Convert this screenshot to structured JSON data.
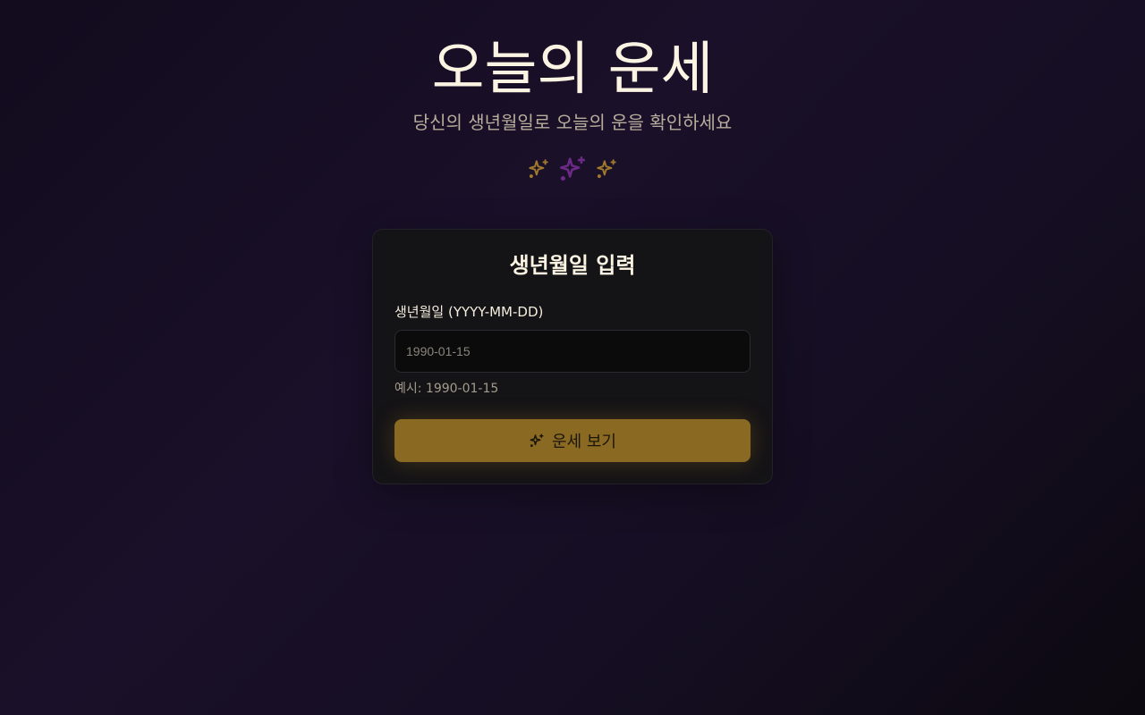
{
  "header": {
    "title": "오늘의 운세",
    "subtitle": "당신의 생년월일로 오늘의 운을 확인하세요",
    "icons": [
      "sparkles-icon",
      "sparkles-icon",
      "sparkles-icon"
    ]
  },
  "form": {
    "title": "생년월일 입력",
    "birthdate_label": "생년월일 (YYYY-MM-DD)",
    "birthdate_placeholder": "1990-01-15",
    "birthdate_value": "",
    "hint": "예시: 1990-01-15",
    "submit_label": "운세 보기",
    "submit_icon": "sparkles-icon"
  },
  "colors": {
    "gold": "#a07a2c",
    "purple": "#6b2a86",
    "button": "#8a6a22"
  }
}
